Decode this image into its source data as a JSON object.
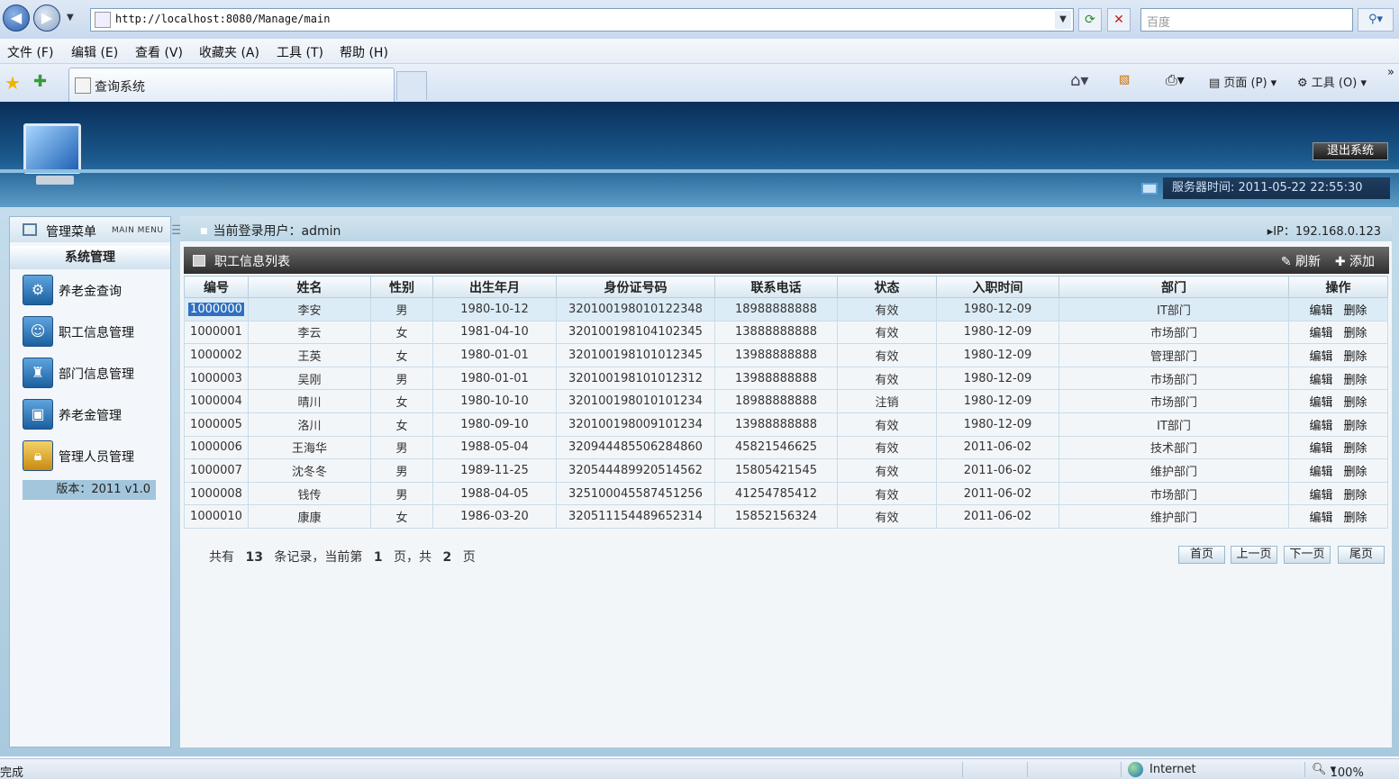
{
  "browser": {
    "url": "http://localhost:8080/Manage/main",
    "search_placeholder": "百度",
    "menu": [
      "文件 (F)",
      "编辑 (E)",
      "查看 (V)",
      "收藏夹 (A)",
      "工具 (T)",
      "帮助 (H)"
    ],
    "tab_title": "查询系统",
    "commands": {
      "page": "页面 (P)",
      "tools": "工具 (O)"
    },
    "status": {
      "left": "完成",
      "zone": "Internet",
      "zoom": "100%"
    }
  },
  "header": {
    "logout_label": "退出系统",
    "server_time": "服务器时间: 2011-05-22 22:55:30"
  },
  "sidebar": {
    "title": "管理菜单",
    "subtitle": "MAIN MENU",
    "group": "系统管理",
    "items": [
      {
        "label": "养老金查询",
        "icon": "gear-icon"
      },
      {
        "label": "职工信息管理",
        "icon": "people-icon"
      },
      {
        "label": "部门信息管理",
        "icon": "department-icon"
      },
      {
        "label": "养老金管理",
        "icon": "pension-icon"
      },
      {
        "label": "管理人员管理",
        "icon": "lock-icon"
      }
    ],
    "version": "版本：2011 v1.0"
  },
  "content": {
    "login_user": "当前登录用户：admin",
    "ip": "▸IP：192.168.0.123",
    "list_title": "职工信息列表",
    "refresh_label": "刷新",
    "add_label": "添加",
    "columns": [
      "编号",
      "姓名",
      "性别",
      "出生年月",
      "身份证号码",
      "联系电话",
      "状态",
      "入职时间",
      "部门",
      "操作"
    ],
    "edit_label": "编辑",
    "delete_label": "删除",
    "rows": [
      [
        "1000000",
        "李安",
        "男",
        "1980-10-12",
        "320100198010122348",
        "18988888888",
        "有效",
        "1980-12-09",
        "IT部门"
      ],
      [
        "1000001",
        "李云",
        "女",
        "1981-04-10",
        "320100198104102345",
        "13888888888",
        "有效",
        "1980-12-09",
        "市场部门"
      ],
      [
        "1000002",
        "王英",
        "女",
        "1980-01-01",
        "320100198101012345",
        "13988888888",
        "有效",
        "1980-12-09",
        "管理部门"
      ],
      [
        "1000003",
        "吴刚",
        "男",
        "1980-01-01",
        "320100198101012312",
        "13988888888",
        "有效",
        "1980-12-09",
        "市场部门"
      ],
      [
        "1000004",
        "晴川",
        "女",
        "1980-10-10",
        "320100198010101234",
        "18988888888",
        "注销",
        "1980-12-09",
        "市场部门"
      ],
      [
        "1000005",
        "洛川",
        "女",
        "1980-09-10",
        "320100198009101234",
        "13988888888",
        "有效",
        "1980-12-09",
        "IT部门"
      ],
      [
        "1000006",
        "王海华",
        "男",
        "1988-05-04",
        "320944485506284860",
        "45821546625",
        "有效",
        "2011-06-02",
        "技术部门"
      ],
      [
        "1000007",
        "沈冬冬",
        "男",
        "1989-11-25",
        "320544489920514562",
        "15805421545",
        "有效",
        "2011-06-02",
        "维护部门"
      ],
      [
        "1000008",
        "钱传",
        "男",
        "1988-04-05",
        "325100045587451256",
        "41254785412",
        "有效",
        "2011-06-02",
        "市场部门"
      ],
      [
        "1000010",
        "康康",
        "女",
        "1986-03-20",
        "320511154489652314",
        "15852156324",
        "有效",
        "2011-06-02",
        "维护部门"
      ]
    ],
    "pager": {
      "prefix": "共有",
      "total": "13",
      "mid": "条记录，当前第",
      "current": "1",
      "mid2": "页，共",
      "pages": "2",
      "suffix": "页",
      "first": "首页",
      "prev": "上一页",
      "next": "下一页",
      "last": "尾页"
    }
  }
}
